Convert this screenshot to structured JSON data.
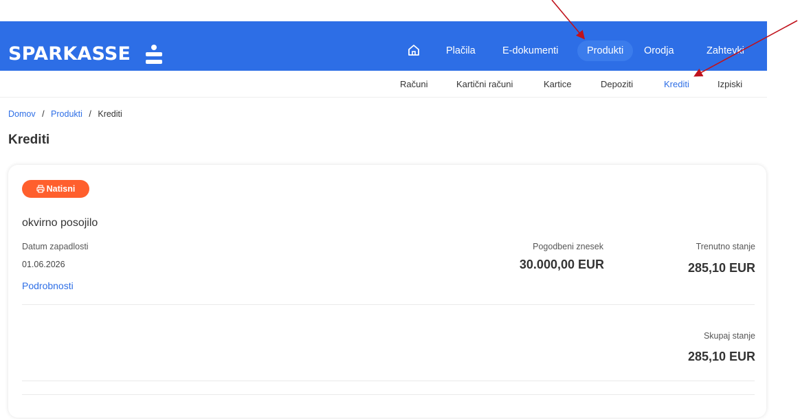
{
  "header": {
    "logo_text": "SPARKASSE",
    "brand_color": "#2d6ee6",
    "nav": [
      {
        "label": "Plačila"
      },
      {
        "label": "E-dokumenti"
      },
      {
        "label": "Produkti",
        "active": true
      },
      {
        "label": "Orodja"
      },
      {
        "label": "Zahtevki"
      }
    ]
  },
  "subnav": [
    {
      "label": "Računi"
    },
    {
      "label": "Kartični računi"
    },
    {
      "label": "Kartice"
    },
    {
      "label": "Depoziti"
    },
    {
      "label": "Krediti",
      "active": true
    },
    {
      "label": "Izpiski"
    }
  ],
  "breadcrumb": {
    "home": "Domov",
    "products": "Produkti",
    "current": "Krediti",
    "separator": "/"
  },
  "page_title": "Krediti",
  "card": {
    "print_label": "Natisni",
    "print_color": "#ff5f2d",
    "loan_name": "okvirno posojilo",
    "due_date_label": "Datum zapadlosti",
    "due_date": "01.06.2026",
    "details_link": "Podrobnosti",
    "contract_amount_label": "Pogodbeni znesek",
    "contract_amount": "30.000,00 EUR",
    "current_balance_label": "Trenutno stanje",
    "current_balance": "285,10 EUR",
    "total_balance_label": "Skupaj stanje",
    "total_balance": "285,10 EUR"
  },
  "annotations": {
    "arrow_color": "#c0121c"
  }
}
